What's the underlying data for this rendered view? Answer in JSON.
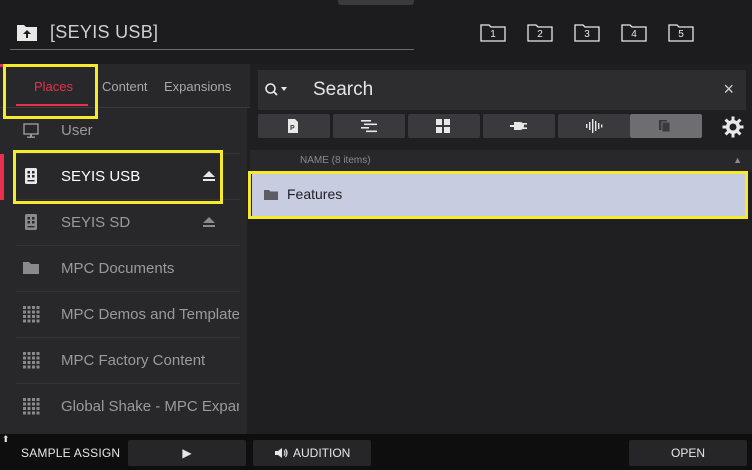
{
  "header": {
    "path": "[SEYIS USB]",
    "quick_folders": [
      "1",
      "2",
      "3",
      "4",
      "5"
    ]
  },
  "tabs": [
    {
      "label": "Places",
      "active": true
    },
    {
      "label": "Content",
      "active": false
    },
    {
      "label": "Expansions",
      "active": false
    }
  ],
  "places": [
    {
      "label": "User",
      "icon": "monitor-icon"
    },
    {
      "label": "SEYIS USB",
      "icon": "drive-icon",
      "selected": true,
      "ejectable": true
    },
    {
      "label": "SEYIS SD",
      "icon": "drive-icon",
      "ejectable": true
    },
    {
      "label": "MPC Documents",
      "icon": "folder-icon"
    },
    {
      "label": "MPC Demos and Templates",
      "icon": "grid-icon"
    },
    {
      "label": "MPC Factory Content",
      "icon": "grid-icon"
    },
    {
      "label": "Global Shake - MPC Expansion",
      "icon": "grid-icon"
    }
  ],
  "search": {
    "placeholder": "Search",
    "close": "×"
  },
  "filters": [
    {
      "icon": "program-icon"
    },
    {
      "icon": "sequence-icon"
    },
    {
      "icon": "grid-icon"
    },
    {
      "icon": "plugin-icon"
    },
    {
      "icon": "waveform-icon"
    },
    {
      "icon": "all-files-icon",
      "active": true
    }
  ],
  "list": {
    "column_name": "NAME (8 items)",
    "sort_indicator": "▲",
    "items": [
      {
        "label": "Features",
        "type": "folder"
      }
    ]
  },
  "footer": {
    "shift_arrow": "⬆",
    "sample_assign": "SAMPLE ASSIGN",
    "play": "▶",
    "audition": "AUDITION",
    "open": "OPEN"
  },
  "colors": {
    "accent": "#e8304e",
    "highlight": "#f6ea2c",
    "selected_row": "#c8cce0"
  }
}
